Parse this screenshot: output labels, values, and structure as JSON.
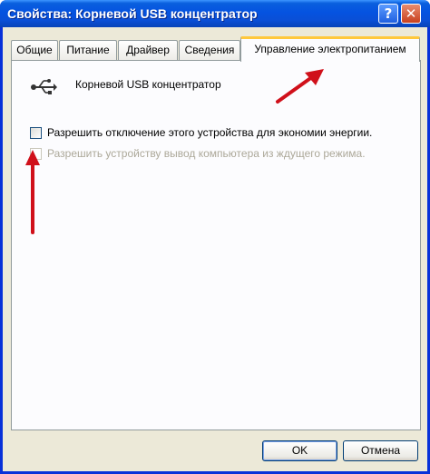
{
  "window": {
    "title": "Свойства: Корневой USB концентратор"
  },
  "titlebar": {
    "help_glyph": "?",
    "close_glyph": "✕"
  },
  "tabs": [
    {
      "label": "Общие"
    },
    {
      "label": "Питание"
    },
    {
      "label": "Драйвер"
    },
    {
      "label": "Сведения"
    },
    {
      "label": "Управление электропитанием",
      "active": true
    }
  ],
  "panel": {
    "device_icon": "usb-icon",
    "device_name": "Корневой USB концентратор",
    "options": [
      {
        "label": "Разрешить отключение этого устройства для экономии энергии.",
        "checked": false,
        "enabled": true
      },
      {
        "label": "Разрешить устройству вывод компьютера из ждущего режима.",
        "checked": false,
        "enabled": false
      }
    ]
  },
  "buttons": {
    "ok": "OK",
    "cancel": "Отмена"
  },
  "colors": {
    "titlebar": "#0553e0",
    "face": "#ece9d8",
    "arrow": "#d0101a",
    "active_tab_accent": "#ffc83c"
  }
}
